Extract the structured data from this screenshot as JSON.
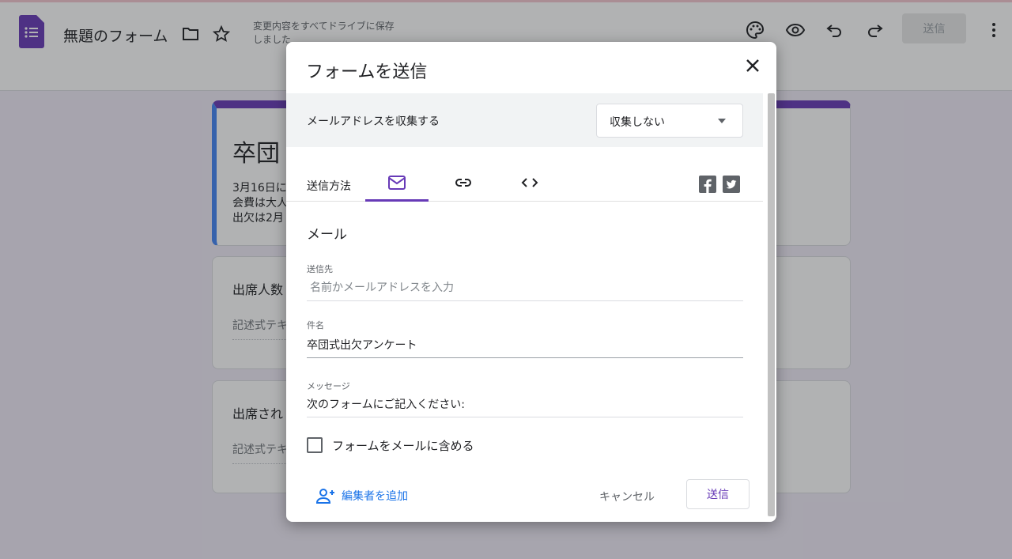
{
  "app": {
    "doc_title": "無題のフォーム",
    "save_status": "変更内容をすべてドライブに保存しました",
    "send_label": "送信"
  },
  "form": {
    "title": "卒団",
    "description_lines": [
      "3月16日に",
      "会費は大人",
      "出欠は2月"
    ],
    "questions": [
      {
        "title": "出席人数",
        "hint": "記述式テキ"
      },
      {
        "title": "出席され",
        "hint": "記述式テキ"
      }
    ]
  },
  "dialog": {
    "title": "フォームを送信",
    "collect_email": {
      "label": "メールアドレスを収集する",
      "value": "収集しない"
    },
    "send_via_label": "送信方法",
    "section_title": "メール",
    "to": {
      "label": "送信先",
      "placeholder": "名前かメールアドレスを入力"
    },
    "subject": {
      "label": "件名",
      "value": "卒団式出欠アンケート"
    },
    "message": {
      "label": "メッセージ",
      "value": "次のフォームにご記入ください:"
    },
    "include_form_label": "フォームをメールに含める",
    "add_editor_label": "編集者を追加",
    "cancel_label": "キャンセル",
    "send_label": "送信"
  },
  "colors": {
    "accent": "#673ab7",
    "link": "#1a73e8",
    "background": "#f0ebf8"
  },
  "icons": {
    "form_logo": "google-forms-icon",
    "folder": "folder-icon",
    "star": "star-icon",
    "palette": "palette-icon",
    "preview": "eye-icon",
    "undo": "undo-icon",
    "redo": "redo-icon",
    "more": "more-vert-icon",
    "close": "close-icon",
    "email_tab": "email-icon",
    "link_tab": "link-icon",
    "embed_tab": "code-icon",
    "facebook": "facebook-icon",
    "twitter": "twitter-icon",
    "add_person": "person-add-icon"
  }
}
